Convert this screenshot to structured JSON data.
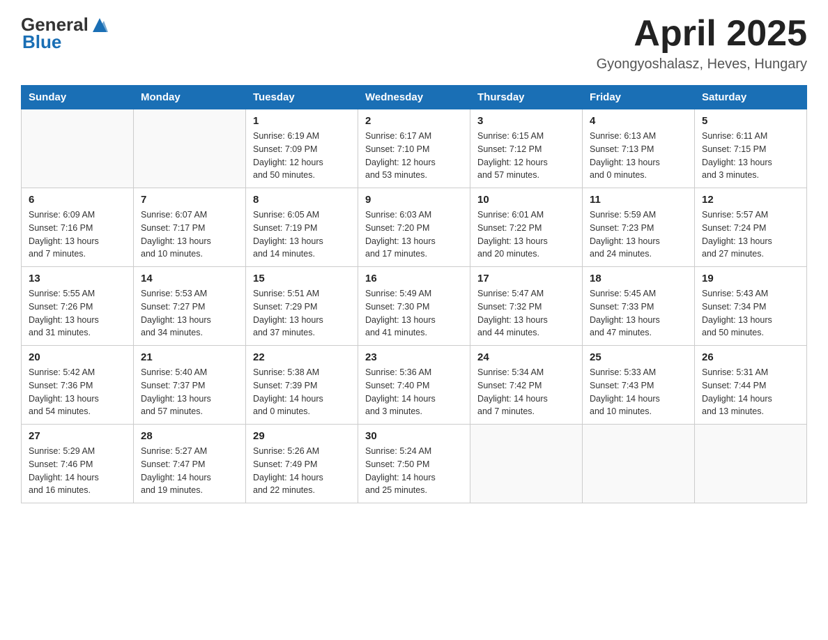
{
  "logo": {
    "text_general": "General",
    "text_blue": "Blue",
    "tagline": ""
  },
  "title": "April 2025",
  "subtitle": "Gyongyoshalasz, Heves, Hungary",
  "days_of_week": [
    "Sunday",
    "Monday",
    "Tuesday",
    "Wednesday",
    "Thursday",
    "Friday",
    "Saturday"
  ],
  "weeks": [
    [
      {
        "day": "",
        "info": ""
      },
      {
        "day": "",
        "info": ""
      },
      {
        "day": "1",
        "info": "Sunrise: 6:19 AM\nSunset: 7:09 PM\nDaylight: 12 hours\nand 50 minutes."
      },
      {
        "day": "2",
        "info": "Sunrise: 6:17 AM\nSunset: 7:10 PM\nDaylight: 12 hours\nand 53 minutes."
      },
      {
        "day": "3",
        "info": "Sunrise: 6:15 AM\nSunset: 7:12 PM\nDaylight: 12 hours\nand 57 minutes."
      },
      {
        "day": "4",
        "info": "Sunrise: 6:13 AM\nSunset: 7:13 PM\nDaylight: 13 hours\nand 0 minutes."
      },
      {
        "day": "5",
        "info": "Sunrise: 6:11 AM\nSunset: 7:15 PM\nDaylight: 13 hours\nand 3 minutes."
      }
    ],
    [
      {
        "day": "6",
        "info": "Sunrise: 6:09 AM\nSunset: 7:16 PM\nDaylight: 13 hours\nand 7 minutes."
      },
      {
        "day": "7",
        "info": "Sunrise: 6:07 AM\nSunset: 7:17 PM\nDaylight: 13 hours\nand 10 minutes."
      },
      {
        "day": "8",
        "info": "Sunrise: 6:05 AM\nSunset: 7:19 PM\nDaylight: 13 hours\nand 14 minutes."
      },
      {
        "day": "9",
        "info": "Sunrise: 6:03 AM\nSunset: 7:20 PM\nDaylight: 13 hours\nand 17 minutes."
      },
      {
        "day": "10",
        "info": "Sunrise: 6:01 AM\nSunset: 7:22 PM\nDaylight: 13 hours\nand 20 minutes."
      },
      {
        "day": "11",
        "info": "Sunrise: 5:59 AM\nSunset: 7:23 PM\nDaylight: 13 hours\nand 24 minutes."
      },
      {
        "day": "12",
        "info": "Sunrise: 5:57 AM\nSunset: 7:24 PM\nDaylight: 13 hours\nand 27 minutes."
      }
    ],
    [
      {
        "day": "13",
        "info": "Sunrise: 5:55 AM\nSunset: 7:26 PM\nDaylight: 13 hours\nand 31 minutes."
      },
      {
        "day": "14",
        "info": "Sunrise: 5:53 AM\nSunset: 7:27 PM\nDaylight: 13 hours\nand 34 minutes."
      },
      {
        "day": "15",
        "info": "Sunrise: 5:51 AM\nSunset: 7:29 PM\nDaylight: 13 hours\nand 37 minutes."
      },
      {
        "day": "16",
        "info": "Sunrise: 5:49 AM\nSunset: 7:30 PM\nDaylight: 13 hours\nand 41 minutes."
      },
      {
        "day": "17",
        "info": "Sunrise: 5:47 AM\nSunset: 7:32 PM\nDaylight: 13 hours\nand 44 minutes."
      },
      {
        "day": "18",
        "info": "Sunrise: 5:45 AM\nSunset: 7:33 PM\nDaylight: 13 hours\nand 47 minutes."
      },
      {
        "day": "19",
        "info": "Sunrise: 5:43 AM\nSunset: 7:34 PM\nDaylight: 13 hours\nand 50 minutes."
      }
    ],
    [
      {
        "day": "20",
        "info": "Sunrise: 5:42 AM\nSunset: 7:36 PM\nDaylight: 13 hours\nand 54 minutes."
      },
      {
        "day": "21",
        "info": "Sunrise: 5:40 AM\nSunset: 7:37 PM\nDaylight: 13 hours\nand 57 minutes."
      },
      {
        "day": "22",
        "info": "Sunrise: 5:38 AM\nSunset: 7:39 PM\nDaylight: 14 hours\nand 0 minutes."
      },
      {
        "day": "23",
        "info": "Sunrise: 5:36 AM\nSunset: 7:40 PM\nDaylight: 14 hours\nand 3 minutes."
      },
      {
        "day": "24",
        "info": "Sunrise: 5:34 AM\nSunset: 7:42 PM\nDaylight: 14 hours\nand 7 minutes."
      },
      {
        "day": "25",
        "info": "Sunrise: 5:33 AM\nSunset: 7:43 PM\nDaylight: 14 hours\nand 10 minutes."
      },
      {
        "day": "26",
        "info": "Sunrise: 5:31 AM\nSunset: 7:44 PM\nDaylight: 14 hours\nand 13 minutes."
      }
    ],
    [
      {
        "day": "27",
        "info": "Sunrise: 5:29 AM\nSunset: 7:46 PM\nDaylight: 14 hours\nand 16 minutes."
      },
      {
        "day": "28",
        "info": "Sunrise: 5:27 AM\nSunset: 7:47 PM\nDaylight: 14 hours\nand 19 minutes."
      },
      {
        "day": "29",
        "info": "Sunrise: 5:26 AM\nSunset: 7:49 PM\nDaylight: 14 hours\nand 22 minutes."
      },
      {
        "day": "30",
        "info": "Sunrise: 5:24 AM\nSunset: 7:50 PM\nDaylight: 14 hours\nand 25 minutes."
      },
      {
        "day": "",
        "info": ""
      },
      {
        "day": "",
        "info": ""
      },
      {
        "day": "",
        "info": ""
      }
    ]
  ]
}
